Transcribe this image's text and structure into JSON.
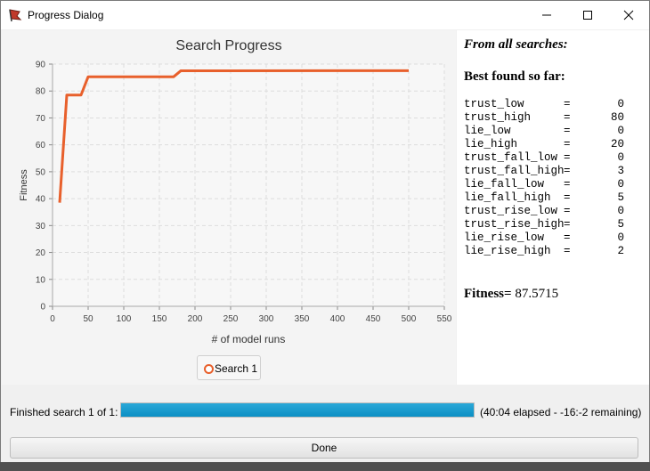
{
  "window": {
    "title": "Progress Dialog"
  },
  "chart_data": {
    "type": "line",
    "title": "Search Progress",
    "xlabel": "# of model runs",
    "ylabel": "Fitness",
    "xlim": [
      0,
      550
    ],
    "ylim": [
      0,
      90
    ],
    "xticks": [
      0,
      50,
      100,
      150,
      200,
      250,
      300,
      350,
      400,
      450,
      500,
      550
    ],
    "yticks": [
      0,
      10,
      20,
      30,
      40,
      50,
      60,
      70,
      80,
      90
    ],
    "grid": true,
    "legend_position": "bottom-center",
    "series": [
      {
        "name": "Search 1",
        "color": "#e8602c",
        "x": [
          10,
          20,
          40,
          50,
          170,
          180,
          500
        ],
        "y": [
          38.5,
          78.5,
          78.5,
          85.3,
          85.3,
          87.5,
          87.5715
        ]
      }
    ]
  },
  "results": {
    "heading_all": "From all searches:",
    "heading_best": "Best found so far:",
    "params": [
      {
        "name": "trust_low",
        "eq": "=",
        "value": "0"
      },
      {
        "name": "trust_high",
        "eq": "=",
        "value": "80"
      },
      {
        "name": "lie_low",
        "eq": "=",
        "value": "0"
      },
      {
        "name": "lie_high",
        "eq": "=",
        "value": "20"
      },
      {
        "name": "trust_fall_low",
        "eq": "=",
        "value": "0"
      },
      {
        "name": "trust_fall_high",
        "eq": "=",
        "value": "3"
      },
      {
        "name": "lie_fall_low",
        "eq": "=",
        "value": "0"
      },
      {
        "name": "lie_fall_high",
        "eq": "=",
        "value": "5"
      },
      {
        "name": "trust_rise_low",
        "eq": "=",
        "value": "0"
      },
      {
        "name": "trust_rise_high",
        "eq": "=",
        "value": "5"
      },
      {
        "name": "lie_rise_low",
        "eq": "=",
        "value": "0"
      },
      {
        "name": "lie_rise_high",
        "eq": "=",
        "value": "2"
      }
    ],
    "fitness_label": "Fitness=",
    "fitness_value": "87.5715"
  },
  "status": {
    "label": "Finished search 1 of 1:",
    "progress": 1.0,
    "progress_color": "#1a9fd0",
    "elapsed_text": "(40:04 elapsed - -16:-2 remaining)"
  },
  "buttons": {
    "done": "Done"
  },
  "icons": {
    "app": "red-flag-app-icon",
    "minimize": "minimize-icon",
    "maximize": "maximize-icon",
    "close": "close-icon"
  }
}
